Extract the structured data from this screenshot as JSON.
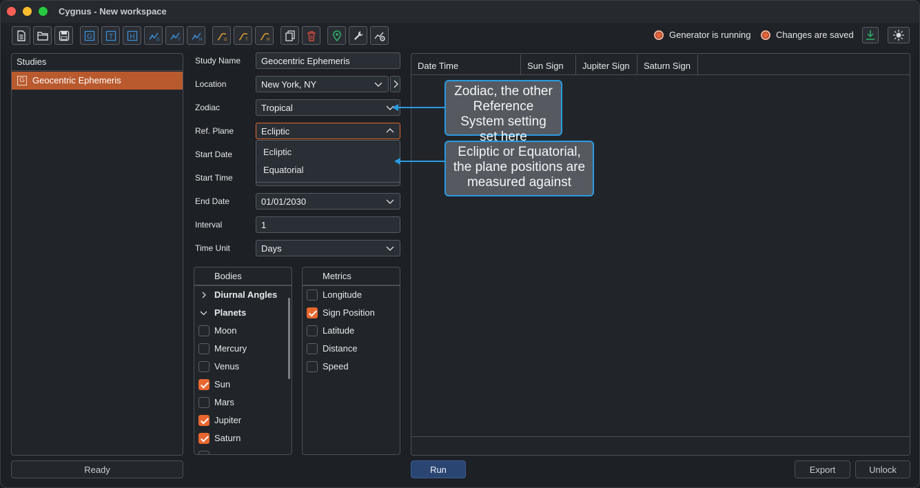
{
  "window": {
    "title": "Cygnus - New workspace"
  },
  "toolbar": {
    "icons": [
      "new-file-icon",
      "open-folder-icon",
      "save-icon",
      "g-study-icon",
      "t-study-icon",
      "h-study-icon",
      "graph-g-icon",
      "graph-t-icon",
      "graph-h-icon",
      "chart-g-icon",
      "chart-t-icon",
      "chart-h-icon",
      "duplicate-icon",
      "delete-icon",
      "location-pin-icon",
      "wrench-icon",
      "settings-graph-icon"
    ],
    "status_generator": "Generator is running",
    "status_changes": "Changes are saved",
    "colors": {
      "status_dot": "#e8643a",
      "accent": "#e8672e",
      "callout_border": "#2b9be0"
    }
  },
  "studies": {
    "header": "Studies",
    "items": [
      {
        "badge": "G",
        "label": "Geocentric Ephemeris"
      }
    ],
    "status_button": "Ready"
  },
  "form": {
    "study_name_label": "Study Name",
    "study_name_value": "Geocentric Ephemeris",
    "location_label": "Location",
    "location_value": "New York, NY",
    "zodiac_label": "Zodiac",
    "zodiac_value": "Tropical",
    "ref_plane_label": "Ref. Plane",
    "ref_plane_value": "Ecliptic",
    "ref_plane_options": [
      "Ecliptic",
      "Equatorial"
    ],
    "start_date_label": "Start Date",
    "start_time_label": "Start Time",
    "end_date_label": "End Date",
    "end_date_value": "01/01/2030",
    "interval_label": "Interval",
    "interval_value": "1",
    "time_unit_label": "Time Unit",
    "time_unit_value": "Days"
  },
  "bodies": {
    "header": "Bodies",
    "groups": [
      {
        "label": "Diurnal Angles",
        "expanded": false
      },
      {
        "label": "Planets",
        "expanded": true
      }
    ],
    "items": [
      {
        "label": "Moon",
        "checked": false
      },
      {
        "label": "Mercury",
        "checked": false
      },
      {
        "label": "Venus",
        "checked": false
      },
      {
        "label": "Sun",
        "checked": true
      },
      {
        "label": "Mars",
        "checked": false
      },
      {
        "label": "Jupiter",
        "checked": true
      },
      {
        "label": "Saturn",
        "checked": true
      }
    ]
  },
  "metrics": {
    "header": "Metrics",
    "items": [
      {
        "label": "Longitude",
        "checked": false
      },
      {
        "label": "Sign Position",
        "checked": true
      },
      {
        "label": "Latitude",
        "checked": false
      },
      {
        "label": "Distance",
        "checked": false
      },
      {
        "label": "Speed",
        "checked": false
      }
    ]
  },
  "table": {
    "columns": [
      "Date Time",
      "Sun Sign",
      "Jupiter Sign",
      "Saturn Sign"
    ]
  },
  "actions": {
    "run": "Run",
    "export": "Export",
    "unlock": "Unlock"
  },
  "callouts": {
    "zodiac": "Zodiac, the other Reference System setting set here",
    "plane": "Ecliptic or Equatorial, the plane positions are measured against"
  }
}
